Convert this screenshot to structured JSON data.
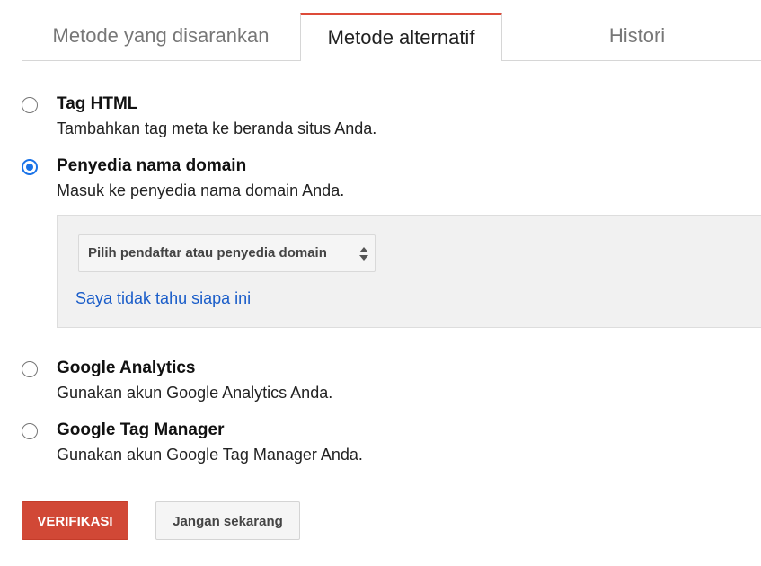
{
  "tabs": [
    {
      "label": "Metode yang disarankan",
      "active": false
    },
    {
      "label": "Metode alternatif",
      "active": true
    },
    {
      "label": "Histori",
      "active": false
    }
  ],
  "options": [
    {
      "title": "Tag HTML",
      "description": "Tambahkan tag meta ke beranda situs Anda.",
      "selected": false
    },
    {
      "title": "Penyedia nama domain",
      "description": "Masuk ke penyedia nama domain Anda.",
      "selected": true
    },
    {
      "title": "Google Analytics",
      "description": "Gunakan akun Google Analytics Anda.",
      "selected": false
    },
    {
      "title": "Google Tag Manager",
      "description": "Gunakan akun Google Tag Manager Anda.",
      "selected": false
    }
  ],
  "domain_panel": {
    "select_value": "Pilih pendaftar atau penyedia domain",
    "help_link": "Saya tidak tahu siapa ini"
  },
  "actions": {
    "verify_label": "VERIFIKASI",
    "later_label": "Jangan sekarang"
  },
  "colors": {
    "accent_red": "#d14836",
    "active_tab_border": "#dd4b39",
    "radio_blue": "#1a73e8",
    "link_blue": "#1a5dc9"
  }
}
